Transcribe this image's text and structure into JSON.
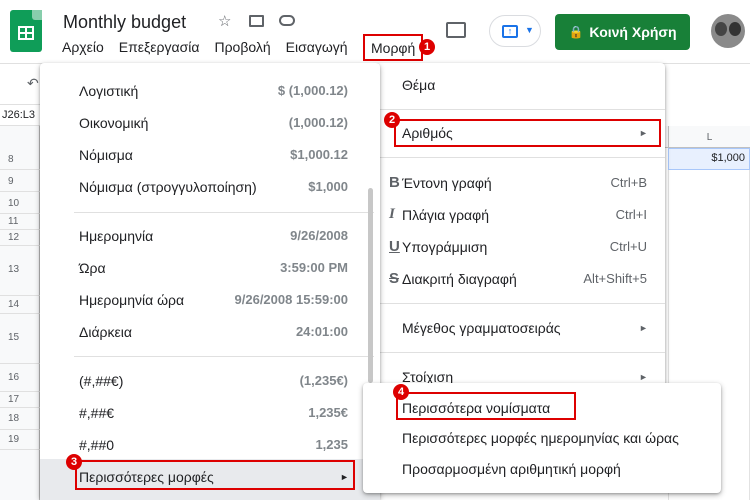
{
  "header": {
    "title": "Monthly budget",
    "menu": [
      "Αρχείο",
      "Επεξεργασία",
      "Προβολή",
      "Εισαγωγή"
    ],
    "menu_format": "Μορφή",
    "share_label": "Κοινή Χρήση"
  },
  "sheet": {
    "namebox": "J26:L3",
    "col_label": "L",
    "cell_value": "$1,000",
    "rows": [
      "8",
      "9",
      "10",
      "11",
      "12",
      "13",
      "14",
      "15",
      "16",
      "17",
      "18",
      "19"
    ]
  },
  "format_menu": {
    "theme": "Θέμα",
    "number": "Αριθμός",
    "bold": "Έντονη γραφή",
    "bold_sc": "Ctrl+B",
    "italic": "Πλάγια γραφή",
    "italic_sc": "Ctrl+I",
    "underline": "Υπογράμμιση",
    "underline_sc": "Ctrl+U",
    "strike": "Διακριτή διαγραφή",
    "strike_sc": "Alt+Shift+5",
    "font_size": "Μέγεθος γραμματοσειράς",
    "align": "Στοίχιση"
  },
  "number_menu": {
    "items": [
      {
        "label": "Λογιστική",
        "example": "$ (1,000.12)"
      },
      {
        "label": "Οικονομική",
        "example": "(1,000.12)"
      },
      {
        "label": "Νόμισμα",
        "example": "$1,000.12"
      },
      {
        "label": "Νόμισμα (στρογγυλοποίηση)",
        "example": "$1,000"
      },
      {
        "label": "Ημερομηνία",
        "example": "9/26/2008"
      },
      {
        "label": "Ώρα",
        "example": "3:59:00 PM"
      },
      {
        "label": "Ημερομηνία ώρα",
        "example": "9/26/2008 15:59:00"
      },
      {
        "label": "Διάρκεια",
        "example": "24:01:00"
      },
      {
        "label": "(#,##€)",
        "example": "(1,235€)"
      },
      {
        "label": "#,##€",
        "example": "1,235€"
      },
      {
        "label": "#,##0",
        "example": "1,235"
      }
    ],
    "more_formats": "Περισσότερες μορφές"
  },
  "more_menu": {
    "currencies": "Περισσότερα νομίσματα",
    "datetime": "Περισσότερες μορφές ημερομηνίας και ώρας",
    "custom": "Προσαρμοσμένη αριθμητική μορφή"
  },
  "steps": [
    "1",
    "2",
    "3",
    "4"
  ],
  "icons": [
    "star-icon",
    "move-folder-icon",
    "cloud-icon",
    "comment-icon",
    "present-icon",
    "lock-icon",
    "undo-icon"
  ],
  "colors": {
    "share": "#188038",
    "highlight": "#dd0000",
    "app": "#0f9d58"
  }
}
